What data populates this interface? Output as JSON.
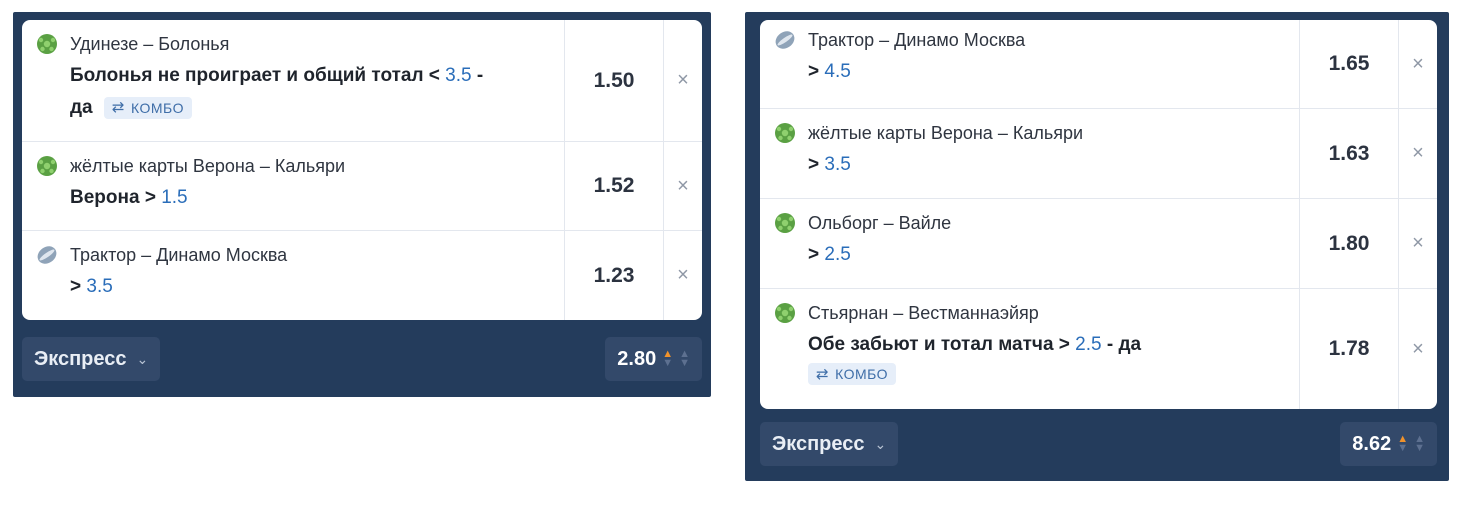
{
  "colors": {
    "panel_bg": "#243c5c",
    "odds_value_blue": "#2a6db9",
    "football_icon": "#5aa043",
    "hockey_icon": "#8fa3b8",
    "odds_up_arrow": "#f0922b"
  },
  "left_slip": {
    "items": [
      {
        "sport_icon": "football-icon",
        "event": "Удинезе – Болонья",
        "bet_text": "Болонья не проиграет и общий тотал < ",
        "bet_value": "3.5",
        "bet_suffix": " -",
        "bet_line2": "да",
        "combo": "КОМБО",
        "odd": "1.50",
        "remove": "×"
      },
      {
        "sport_icon": "football-icon",
        "event": "жёлтые карты Верона – Кальяри",
        "bet_text": "Верона > ",
        "bet_value": "1.5",
        "odd": "1.52",
        "remove": "×"
      },
      {
        "sport_icon": "hockey-puck-icon",
        "event": "Трактор – Динамо Москва",
        "bet_text": "> ",
        "bet_value": "3.5",
        "odd": "1.23",
        "remove": "×"
      }
    ],
    "bet_type": "Экспресс",
    "total_odd": "2.80"
  },
  "right_slip": {
    "items": [
      {
        "sport_icon": "hockey-puck-icon",
        "event": "Трактор – Динамо Москва",
        "bet_text": "> ",
        "bet_value": "4.5",
        "odd": "1.65",
        "remove": "×"
      },
      {
        "sport_icon": "football-icon",
        "event": "жёлтые карты Верона – Кальяри",
        "bet_text": "> ",
        "bet_value": "3.5",
        "odd": "1.63",
        "remove": "×"
      },
      {
        "sport_icon": "football-icon",
        "event": "Ольборг – Вайле",
        "bet_text": "> ",
        "bet_value": "2.5",
        "odd": "1.80",
        "remove": "×"
      },
      {
        "sport_icon": "football-icon",
        "event": "Стьярнан – Вестманнаэйяр",
        "bet_text": "Обе забьют и тотал матча > ",
        "bet_value": "2.5",
        "bet_suffix": " - да",
        "combo": "КОМБО",
        "odd": "1.78",
        "remove": "×"
      }
    ],
    "bet_type": "Экспресс",
    "total_odd": "8.62"
  }
}
